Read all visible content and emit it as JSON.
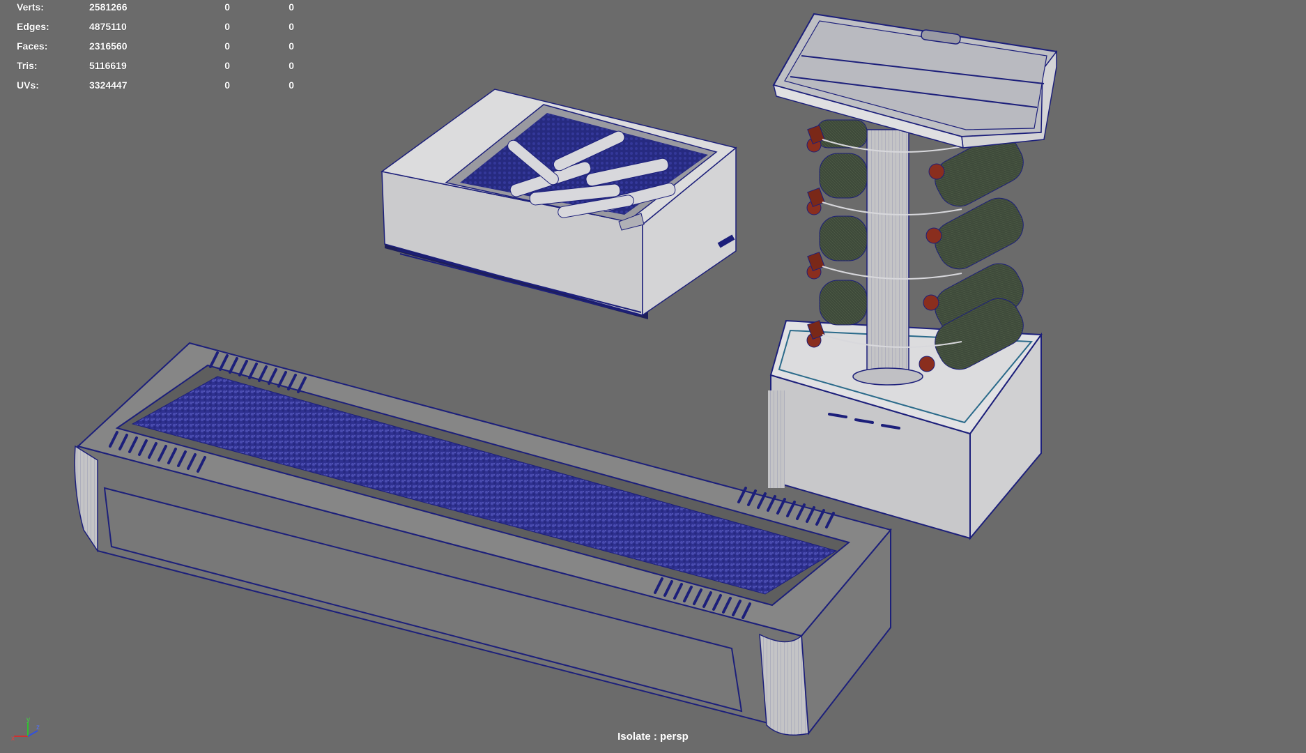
{
  "hud": {
    "rows": [
      {
        "label": "Verts:",
        "total": "2581266",
        "selected": "0",
        "components": "0"
      },
      {
        "label": "Edges:",
        "total": "4875110",
        "selected": "0",
        "components": "0"
      },
      {
        "label": "Faces:",
        "total": "2316560",
        "selected": "0",
        "components": "0"
      },
      {
        "label": "Tris:",
        "total": "5116619",
        "selected": "0",
        "components": "0"
      },
      {
        "label": "UVs:",
        "total": "3324447",
        "selected": "0",
        "components": "0"
      }
    ]
  },
  "viewport": {
    "isolate_label": "Isolate : persp",
    "background_color": "#6b6b6b",
    "wire_color": "#1c1f7a",
    "surface_color": "#c9c9c9",
    "ice_color": "#3a3c9a",
    "bottle_cap_color": "#8a2e1e",
    "bottle_glass_color": "#3c4a38"
  },
  "axis": {
    "x": "x",
    "y": "y",
    "z": "z"
  }
}
